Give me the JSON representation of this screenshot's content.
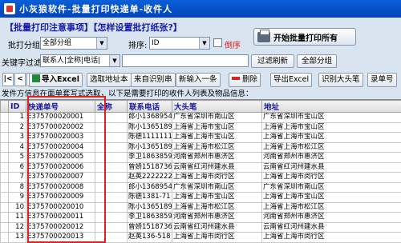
{
  "window": {
    "title": "小灰狼软件-批量打印快递单-收件人"
  },
  "links": {
    "notice": "【批量打印注意事项】【怎样设置批打纸张?】"
  },
  "filters": {
    "group_label": "批打分组",
    "group_value": "全部分组",
    "sort_label": "排序:",
    "sort_value": "ID",
    "desc_label": "倒序",
    "keyword_label": "关键字过滤",
    "keyword_fields": "联系人|全称|电话|",
    "filter_button": "过滤刷新",
    "all_groups_button": "全部分组"
  },
  "print_button": "开始批量打印所有",
  "toolbar": {
    "nav_first": "|<",
    "nav_prev": "<",
    "nav_next": ">",
    "import_excel": "导入Excel",
    "pick_address_book": "选取地址本",
    "from_recognition": "来自识别串",
    "new_entry": "新输入一条",
    "delete": "删除",
    "export_excel": "导出Excel",
    "recognize_head": "识别大头笔",
    "enter_number": "录单号"
  },
  "info_text": "发件方信息在面单套写式选取，以下是需要打印的收件人列表及物品信息：",
  "table": {
    "headers": [
      "ID",
      "I",
      "快递单号",
      "全称",
      "联系电话",
      "大头笔",
      "地址"
    ],
    "rows": [
      [
        "1",
        "E375700020001",
        "",
        "郎小1368954",
        "广东省深圳市南山区",
        "广东省深圳市宝山区"
      ],
      [
        "2",
        "E375700020002",
        "",
        "陈小1365189",
        "上海省上海市宝山区",
        "上海省上海市宝山区"
      ],
      [
        "3",
        "E375700020003",
        "",
        "陈德1111111",
        "上海省上海市宝山区",
        "上海省上海市宝山区"
      ],
      [
        "4",
        "E375700020004",
        "",
        "陈小1365189",
        "上海省上海市松江区",
        "上海省上海市松江区"
      ],
      [
        "5",
        "E375700020005",
        "",
        "李卫1863859",
        "河南省郑州市惠济区",
        "河南省郑州市惠济区"
      ],
      [
        "6",
        "E375700020006",
        "",
        "曾娇1518736",
        "云南省红河州建水县",
        "云南省红河州建水县"
      ],
      [
        "7",
        "E375700020007",
        "",
        "赵英2222222",
        "上海省上海市闵行区",
        "上海省上海市闵行区"
      ],
      [
        "8",
        "E375700020008",
        "",
        "郎小1368954",
        "广东省深圳市南山区",
        "广东省深圳市南山区"
      ],
      [
        "9",
        "E375700020009",
        "",
        "陈德1381-71",
        "上海省上海市宝山区",
        "上海省上海市宝山区"
      ],
      [
        "10",
        "E375700020010",
        "",
        "陈小1365189",
        "上海省上海市松江区",
        "上海省上海市松江区"
      ],
      [
        "11",
        "E375700020011",
        "",
        "李卫1863859",
        "河南省郑州市惠济区",
        "河南省郑州市惠济区"
      ],
      [
        "12",
        "E375700020012",
        "",
        "曾娇1518736",
        "云南省红河州建水县",
        "云南省红河州建水县"
      ],
      [
        "13",
        "E375700020013",
        "",
        "赵英136-518",
        "上海省上海市闵行区",
        "上海省上海市闵行区"
      ]
    ]
  },
  "colors": {
    "highlight_box": "#e02020",
    "title_bar": "#0a5fd8"
  }
}
